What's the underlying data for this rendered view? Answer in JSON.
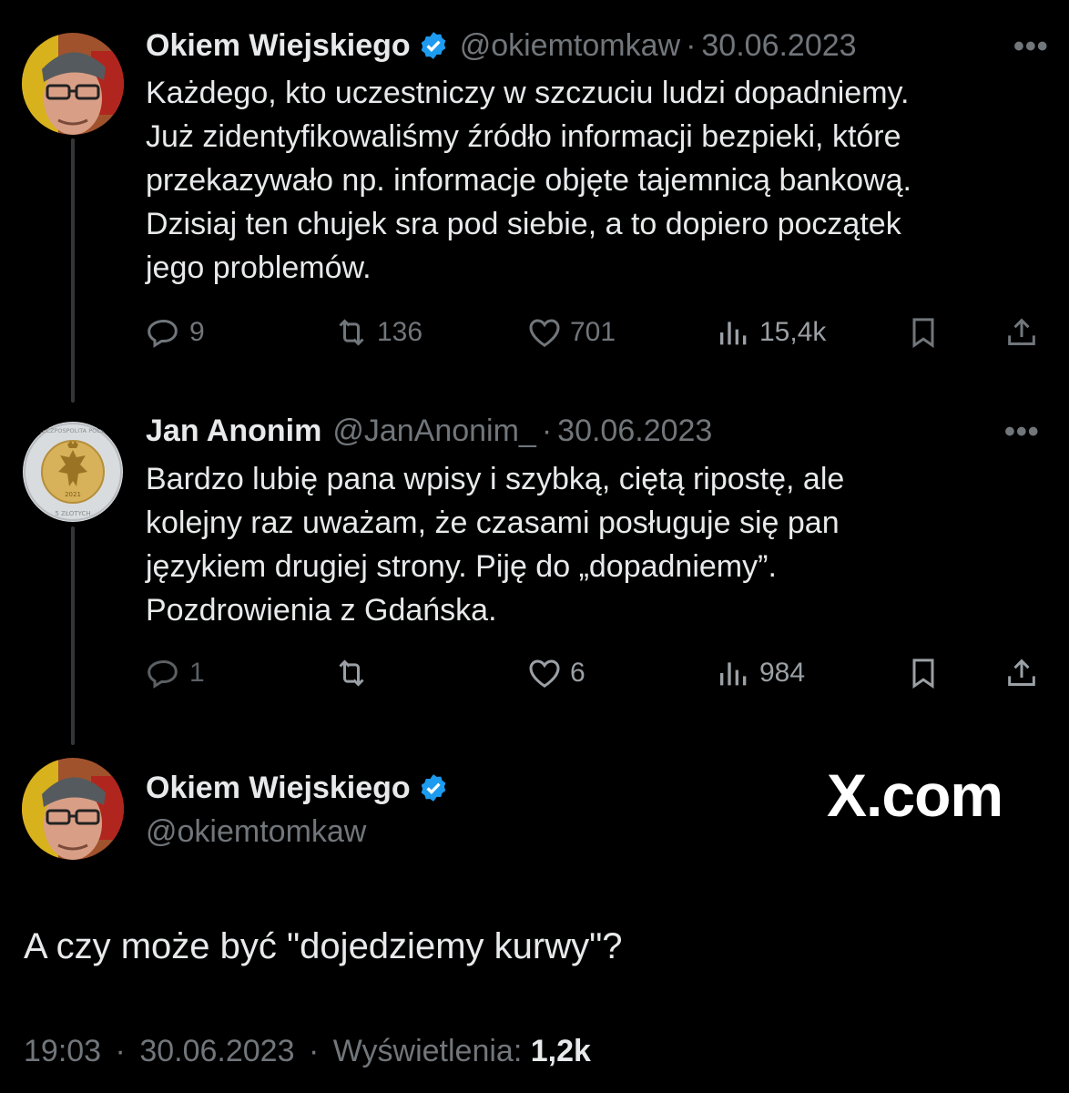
{
  "tweet1": {
    "name": "Okiem Wiejskiego",
    "handle": "@okiemtomkaw",
    "date": "30.06.2023",
    "text": "Każdego, kto uczestniczy w szczuciu ludzi dopadniemy.\nJuż zidentyfikowaliśmy źródło informacji bezpieki, które\nprzekazywało np. informacje objęte tajemnicą bankową.\nDzisiaj ten chujek sra pod siebie, a to dopiero początek\njego problemów.",
    "replies": "9",
    "retweets": "136",
    "likes": "701",
    "views": "15,4k"
  },
  "tweet2": {
    "name": "Jan Anonim",
    "handle": "@JanAnonim_",
    "date": "30.06.2023",
    "text": "Bardzo lubię pana wpisy i szybką, ciętą ripostę, ale\nkolejny raz uważam, że czasami posługuje się pan\njęzykiem drugiej strony. Piję do „dopadniemy”.\nPozdrowienia z Gdańska.",
    "replies": "1",
    "likes": "6",
    "views": "984",
    "coin_text": "RZECZPOSPOLITA POLSKA",
    "coin_year": "2021",
    "coin_value": "5 ZŁOTYCH"
  },
  "tweet3": {
    "name": "Okiem Wiejskiego",
    "handle": "@okiemtomkaw",
    "text": "A czy może być \"dojedziemy kurwy\"?",
    "time": "19:03",
    "date": "30.06.2023",
    "views_label": "Wyświetlenia:",
    "views": "1,2k"
  },
  "brand": "X.com",
  "sep": "·",
  "more": "•••",
  "colors": {
    "verified": "#1d9bf0",
    "muted": "#71767b",
    "text": "#e7e9ea"
  }
}
